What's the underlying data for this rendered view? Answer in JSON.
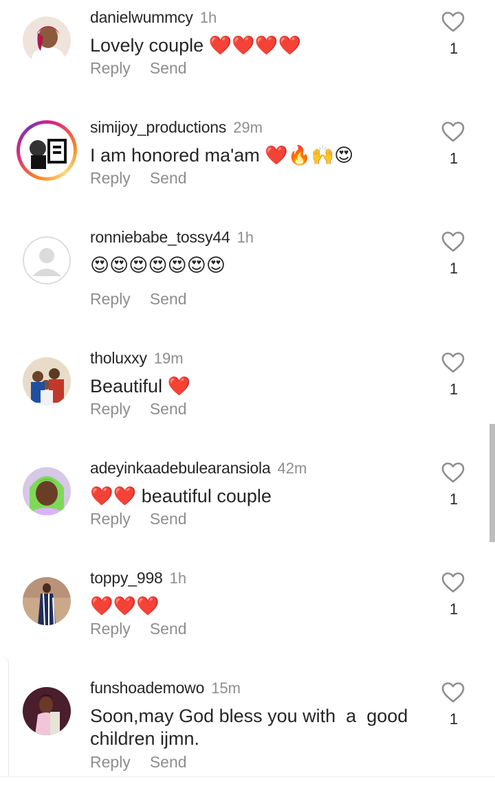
{
  "comments": [
    {
      "username": "danielwummcy",
      "time": "1h",
      "text": "Lovely couple ❤️❤️❤️❤️",
      "reply_label": "Reply",
      "send_label": "Send",
      "likes": "1",
      "avatar": "photo-woman-white-dress",
      "story_ring": false
    },
    {
      "username": "simijoy_productions",
      "time": "29m",
      "text": "I am honored ma'am ❤️🔥🙌😍",
      "reply_label": "Reply",
      "send_label": "Send",
      "likes": "1",
      "avatar": "logo-black-white",
      "story_ring": true
    },
    {
      "username": "ronniebabe_tossy44",
      "time": "1h",
      "text": "😍😍😍😍😍😍😍",
      "reply_label": "Reply",
      "send_label": "Send",
      "likes": "1",
      "avatar": "default-avatar",
      "story_ring": false
    },
    {
      "username": "tholuxxy",
      "time": "19m",
      "text": "Beautiful ❤️",
      "reply_label": "Reply",
      "send_label": "Send",
      "likes": "1",
      "avatar": "photo-family",
      "story_ring": false
    },
    {
      "username": "adeyinkaadebulearansiola",
      "time": "42m",
      "text": "❤️❤️ beautiful couple",
      "reply_label": "Reply",
      "send_label": "Send",
      "likes": "1",
      "avatar": "photo-woman-green-headwrap",
      "story_ring": false
    },
    {
      "username": "toppy_998",
      "time": "1h",
      "text": "❤️❤️❤️",
      "reply_label": "Reply",
      "send_label": "Send",
      "likes": "1",
      "avatar": "photo-woman-striped-dress",
      "story_ring": false
    },
    {
      "username": "funshoademowo",
      "time": "15m",
      "text": "Soon,may God bless you with  a  good children ijmn.",
      "reply_label": "Reply",
      "send_label": "Send",
      "likes": "1",
      "avatar": "photo-woman-pink",
      "story_ring": false
    }
  ],
  "icons": {
    "like": "heart-outline-icon"
  },
  "colors": {
    "text": "#262626",
    "secondary": "#8e8e8e",
    "heart": "#e0242c"
  }
}
